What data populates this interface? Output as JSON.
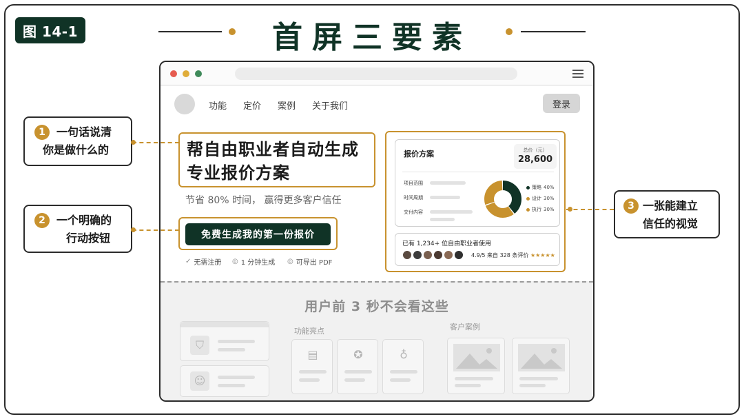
{
  "figure_label": "图 14-1",
  "title": "首屏三要素",
  "browser": {
    "nav": {
      "items": [
        "功能",
        "定价",
        "案例",
        "关于我们"
      ],
      "login": "登录"
    },
    "hero": {
      "headline_line1": "帮自由职业者自动生成",
      "headline_line2": "专业报价方案",
      "subtitle": "节省 80% 时间， 赢得更多客户信任",
      "cta": "免费生成我的第一份报价",
      "features": [
        {
          "icon": "check-icon",
          "label": "无需注册"
        },
        {
          "icon": "clock-icon",
          "label": "1 分钟生成"
        },
        {
          "icon": "export-icon",
          "label": "可导出 PDF"
        }
      ]
    },
    "visual": {
      "card_title": "报价方案",
      "total_label": "总价（元）",
      "total_value": "28,600",
      "rows": [
        "项目范围",
        "时间周期",
        "交付内容"
      ],
      "chart_data": {
        "type": "pie",
        "categories": [
          "策略",
          "设计",
          "执行"
        ],
        "values": [
          40,
          30,
          30
        ],
        "colors": [
          "#103326",
          "#c8922e",
          "#c8922e"
        ]
      },
      "legend_values": [
        "40%",
        "30%",
        "30%"
      ],
      "social_title": "已有 1,234+ 位自由职业者使用",
      "rating": "4.9/5 来自 328 条评价",
      "stars": "★★★★★"
    },
    "below_fold": {
      "title": "用户前 3 秒不会看这些",
      "features_label": "功能亮点",
      "cases_label": "客户案例"
    }
  },
  "callouts": [
    {
      "number": "1",
      "line1": "一句话说清",
      "line2": "你是做什么的"
    },
    {
      "number": "2",
      "line1": "一个明确的",
      "line2": "行动按钮"
    },
    {
      "number": "3",
      "line1": "一张能建立",
      "line2": "信任的视觉"
    }
  ],
  "colors": {
    "brand": "#103326",
    "accent": "#c8922e"
  }
}
